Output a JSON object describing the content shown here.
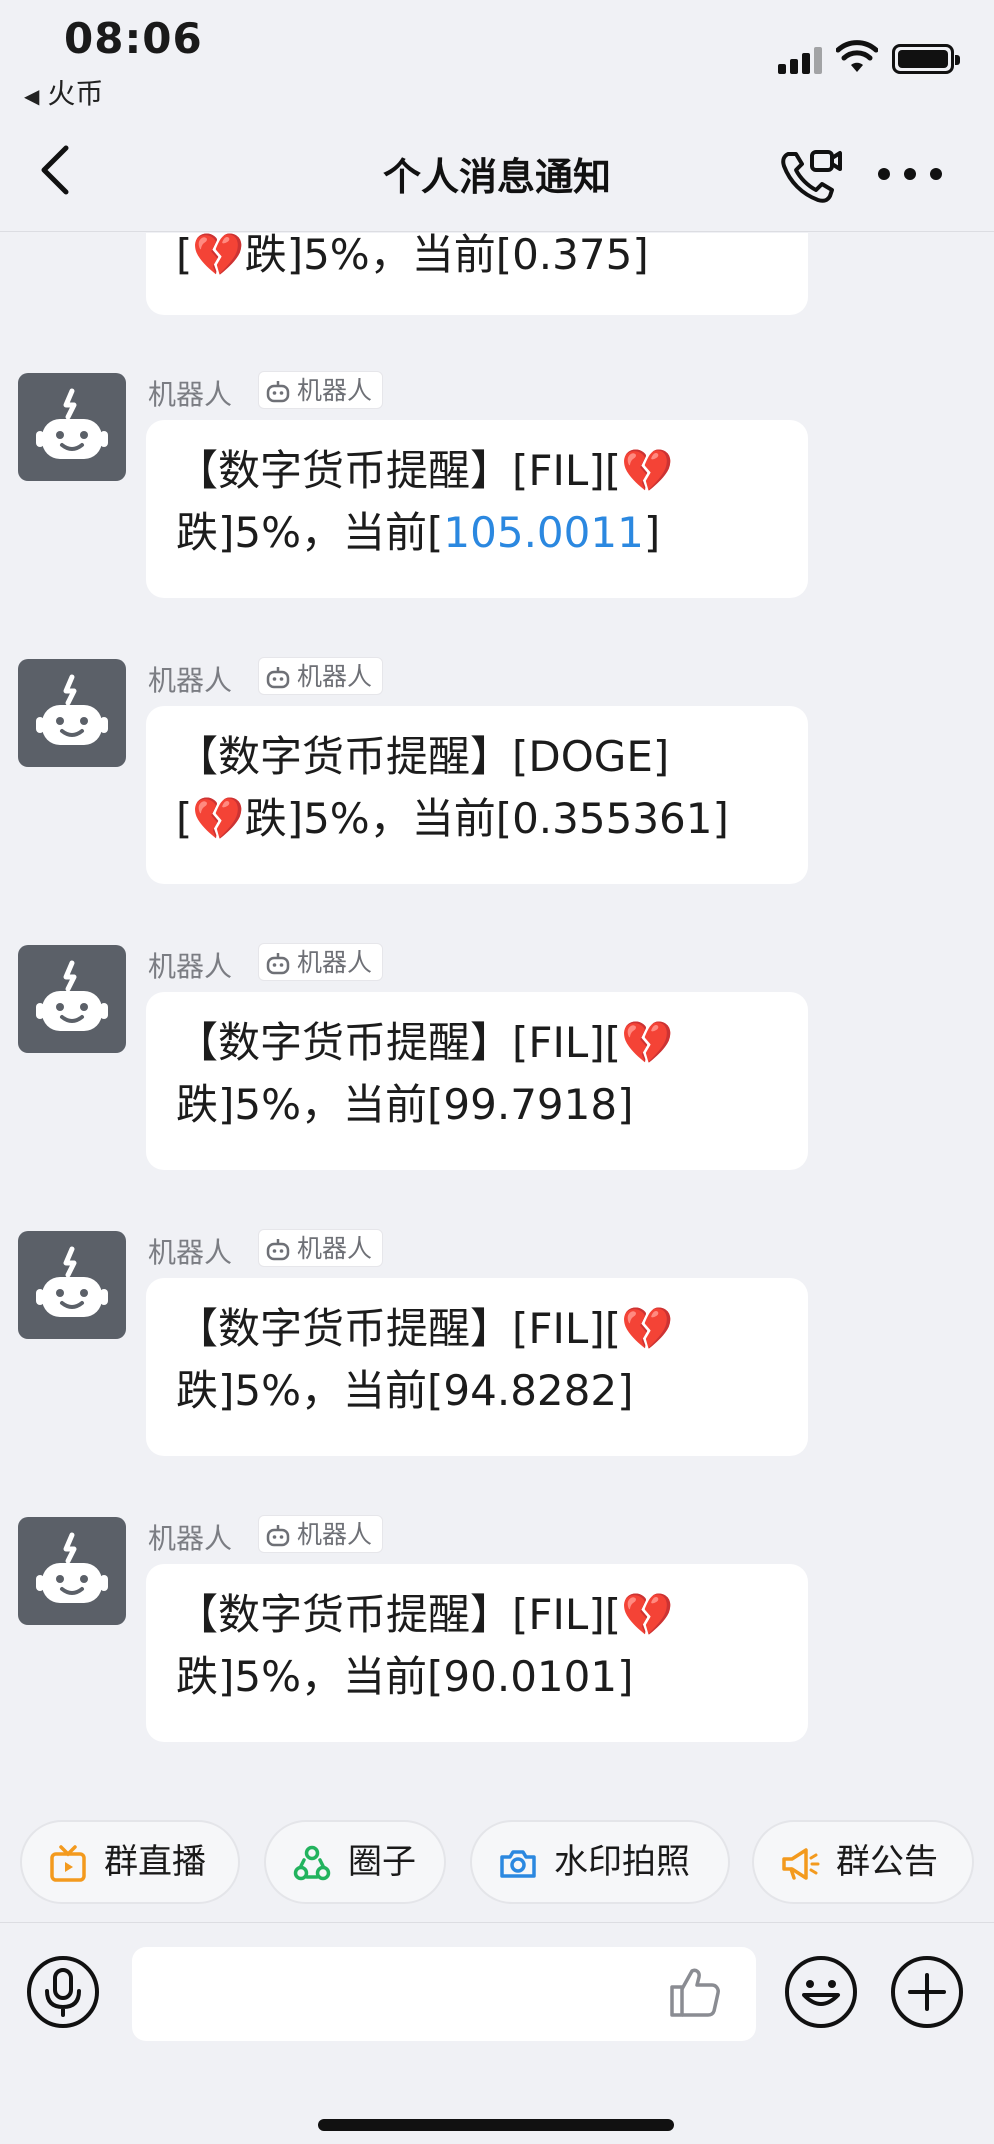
{
  "status_bar": {
    "time": "08:06",
    "back_app": "火币"
  },
  "nav": {
    "title": "个人消息通知"
  },
  "partial_message": {
    "prefix": "[",
    "emoji": "💔",
    "text": "跌]5%，当前[0.375]"
  },
  "messages": [
    {
      "sender": "机器人",
      "tag": "机器人",
      "line1": "【数字货币提醒】[FIL][",
      "emoji": "💔",
      "line2_pre": "跌]5%，当前[",
      "value": "105.0011",
      "line2_post": "]"
    },
    {
      "sender": "机器人",
      "tag": "机器人",
      "line1": "【数字货币提醒】[DOGE]",
      "line2_pre": "[",
      "emoji": "💔",
      "line2_text": "跌]5%，当前[0.355361]"
    },
    {
      "sender": "机器人",
      "tag": "机器人",
      "line1": "【数字货币提醒】[FIL][",
      "emoji": "💔",
      "line2": "跌]5%，当前[99.7918]"
    },
    {
      "sender": "机器人",
      "tag": "机器人",
      "line1": "【数字货币提醒】[FIL][",
      "emoji": "💔",
      "line2": "跌]5%，当前[94.8282]"
    },
    {
      "sender": "机器人",
      "tag": "机器人",
      "line1": "【数字货币提醒】[FIL][",
      "emoji": "💔",
      "line2": "跌]5%，当前[90.0101]"
    }
  ],
  "chips": [
    {
      "label": "群直播",
      "icon": "live-tv-icon",
      "color": "#f39a1e"
    },
    {
      "label": "圈子",
      "icon": "circle-group-icon",
      "color": "#22b35e"
    },
    {
      "label": "水印拍照",
      "icon": "camera-icon",
      "color": "#2b88e0"
    },
    {
      "label": "群公告",
      "icon": "megaphone-icon",
      "color": "#f39a1e"
    }
  ],
  "colors": {
    "background": "#f0f1f5",
    "bubble": "#ffffff",
    "link": "#2b88e0",
    "avatar": "#5b6068"
  }
}
